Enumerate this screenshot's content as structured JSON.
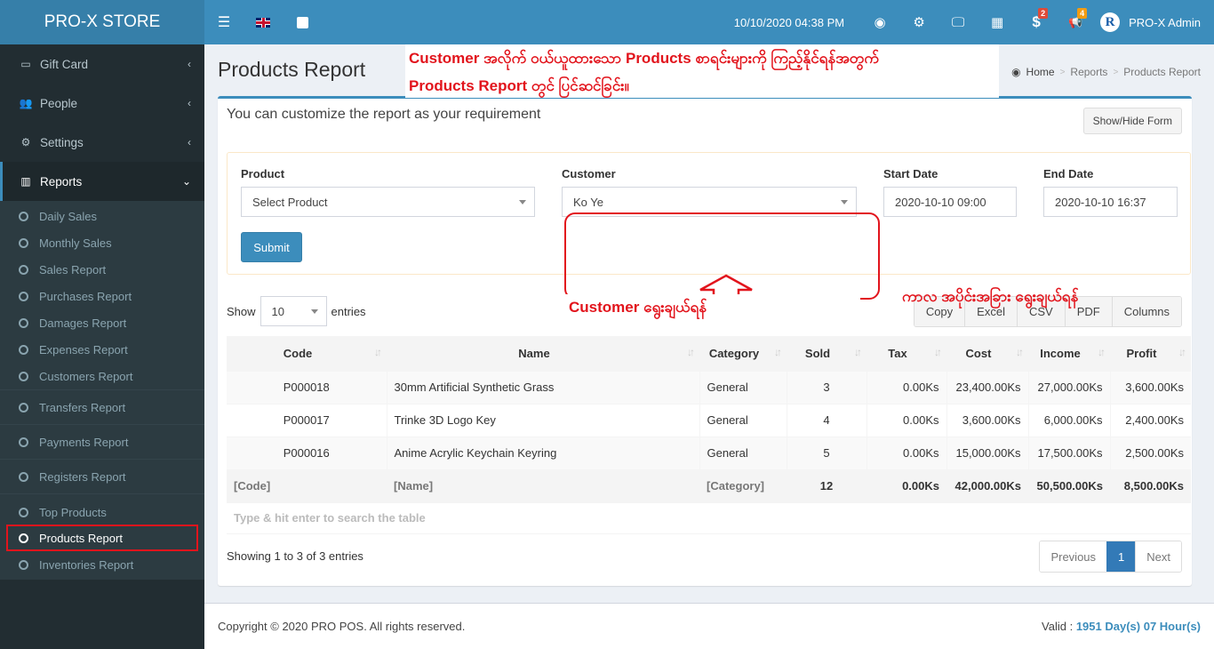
{
  "app": {
    "brand": "PRO-X STORE"
  },
  "header": {
    "datetime": "10/10/2020 04:38 PM",
    "icons": {
      "menu": "☰",
      "dashboard": "◉",
      "settings": "⚙",
      "pos": "🖵",
      "grid": "▦",
      "sales": "$",
      "notifications": "📢"
    },
    "badges": {
      "sales": "2",
      "notifications": "4"
    },
    "badge_colors": {
      "sales": "#dd4b39",
      "notifications": "#f39c12"
    },
    "avatar_letter": "R",
    "user_name": "PRO-X Admin"
  },
  "sidebar": {
    "top_items": [
      {
        "label": "Gift Card",
        "icon": "▭"
      },
      {
        "label": "People",
        "icon": "👥"
      },
      {
        "label": "Settings",
        "icon": "⚙"
      }
    ],
    "reports": {
      "label": "Reports",
      "icon": "▥"
    },
    "sub_items": [
      "Daily Sales",
      "Monthly Sales",
      "Sales Report",
      "Purchases Report",
      "Damages Report",
      "Expenses Report",
      "Customers Report",
      "Transfers Report",
      "Payments Report",
      "Registers Report",
      "Top Products",
      "Products Report",
      "Inventories Report"
    ]
  },
  "page": {
    "title": "Products Report",
    "breadcrumb": [
      "Home",
      "Reports",
      "Products Report"
    ],
    "intro": "You can customize the report as your requirement",
    "toggle_form": "Show/Hide Form"
  },
  "annotations": {
    "top_line1": "Customer အလိုက် ဝယ်ယူထားသော Products စာရင်းများကို ကြည့်နိုင်ရန်အတွက်",
    "top_line2": "Products Report တွင် ပြင်ဆင်ခြင်း။",
    "customer_hint": "Customer ရွေးချယ်ရန်",
    "date_hint": "ကာလ အပိုင်းအခြား ရွေးချယ်ရန်",
    "color": "#e2141c"
  },
  "form": {
    "product_label": "Product",
    "product_value": "Select Product",
    "customer_label": "Customer",
    "customer_value": "Ko Ye",
    "start_label": "Start Date",
    "start_value": "2020-10-10 09:00",
    "end_label": "End Date",
    "end_value": "2020-10-10 16:37",
    "submit": "Submit"
  },
  "table_controls": {
    "show": "Show",
    "length": "10",
    "entries": "entries",
    "buttons": [
      "Copy",
      "Excel",
      "CSV",
      "PDF",
      "Columns"
    ]
  },
  "table": {
    "columns": [
      "Code",
      "Name",
      "Category",
      "Sold",
      "Tax",
      "Cost",
      "Income",
      "Profit"
    ],
    "rows": [
      [
        "P000018",
        "30mm Artificial Synthetic Grass",
        "General",
        "3",
        "0.00Ks",
        "23,400.00Ks",
        "27,000.00Ks",
        "3,600.00Ks"
      ],
      [
        "P000017",
        "Trinke 3D Logo Key",
        "General",
        "4",
        "0.00Ks",
        "3,600.00Ks",
        "6,000.00Ks",
        "2,400.00Ks"
      ],
      [
        "P000016",
        "Anime Acrylic Keychain Keyring",
        "General",
        "5",
        "0.00Ks",
        "15,000.00Ks",
        "17,500.00Ks",
        "2,500.00Ks"
      ]
    ],
    "footer": [
      "[Code]",
      "[Name]",
      "[Category]",
      "12",
      "0.00Ks",
      "42,000.00Ks",
      "50,500.00Ks",
      "8,500.00Ks"
    ],
    "search_placeholder": "Type & hit enter to search the table"
  },
  "pagination": {
    "info": "Showing 1 to 3 of 3 entries",
    "previous": "Previous",
    "current": "1",
    "next": "Next"
  },
  "footer": {
    "copyright": "Copyright © 2020 PRO POS. All rights reserved.",
    "valid_label": "Valid : ",
    "valid_value": "1951 Day(s) 07 Hour(s)"
  }
}
